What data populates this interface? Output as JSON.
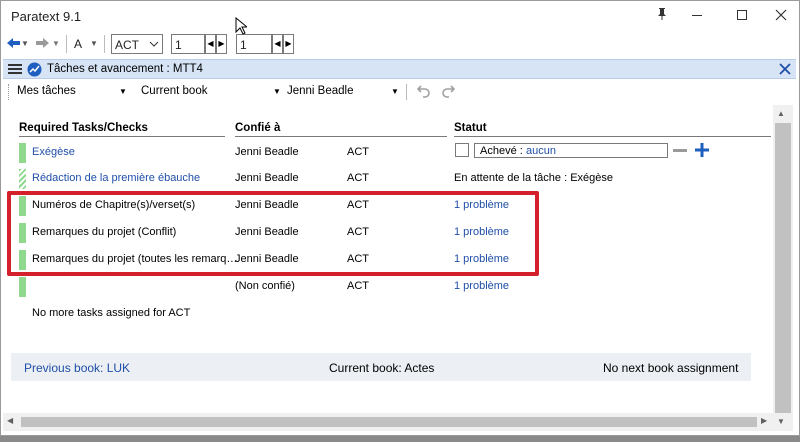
{
  "app": {
    "title": "Paratext 9.1"
  },
  "toolbar": {
    "font_label": "A",
    "book": "ACT",
    "chapter": "1",
    "verse": "1"
  },
  "panel": {
    "title": "Tâches et avancement : MTT4"
  },
  "filters": {
    "tasks": "Mes tâches",
    "scope": "Current book",
    "user": "Jenni Beadle"
  },
  "headers": {
    "tasks": "Required Tasks/Checks",
    "assigned": "Confié à",
    "status": "Statut"
  },
  "rows": [
    {
      "task": "Exégèse",
      "assignee": "Jenni Beadle",
      "book": "ACT",
      "status": ""
    },
    {
      "task": "Rédaction de la première ébauche",
      "assignee": "Jenni Beadle",
      "book": "ACT",
      "status": "En attente de la tâche : Exégèse"
    },
    {
      "task": "Numéros de Chapitre(s)/verset(s)",
      "assignee": "Jenni Beadle",
      "book": "ACT",
      "status": "1 problème"
    },
    {
      "task": "Remarques du projet (Conflit)",
      "assignee": "Jenni Beadle",
      "book": "ACT",
      "status": "1 problème"
    },
    {
      "task": "Remarques du projet (toutes les remarq…",
      "assignee": "Jenni Beadle",
      "book": "ACT",
      "status": "1 problème"
    },
    {
      "task": "",
      "assignee": "(Non confié)",
      "book": "ACT",
      "status": "1 problème"
    }
  ],
  "status_field": {
    "label": "Achevé : ",
    "value": "aucun"
  },
  "no_more": "No more tasks assigned for ACT",
  "footer": {
    "previous": "Previous book: LUK",
    "current": "Current book: Actes",
    "next": "No next book assignment"
  },
  "colors": {
    "accent": "#1f4fa8",
    "highlight_box": "#d3202a",
    "progress_bar": "#8fd98f",
    "panel_header": "#d6e4f5"
  }
}
